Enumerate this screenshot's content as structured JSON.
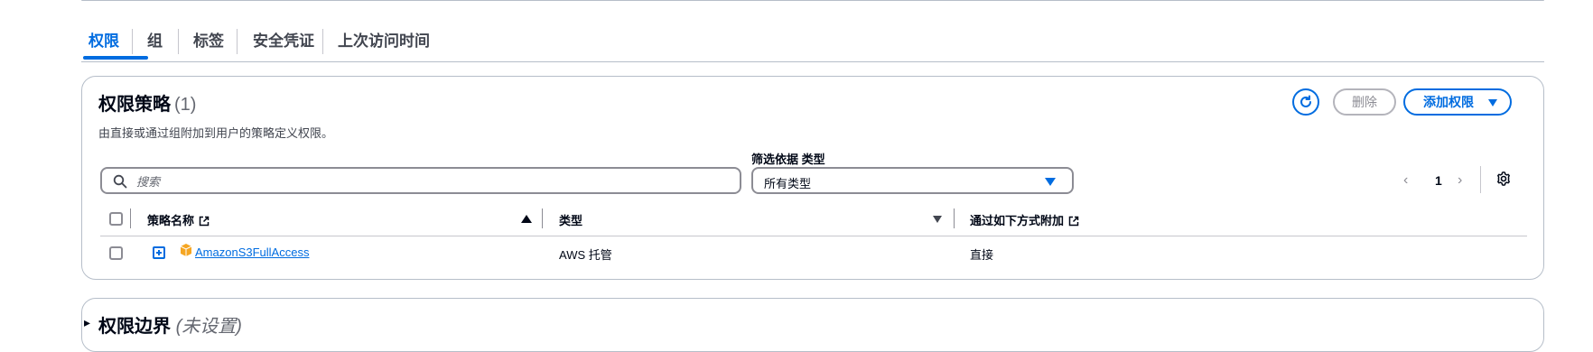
{
  "tabs": [
    {
      "label": "权限",
      "active": true
    },
    {
      "label": "组"
    },
    {
      "label": "标签"
    },
    {
      "label": "安全凭证"
    },
    {
      "label": "上次访问时间"
    }
  ],
  "policies": {
    "title": "权限策略",
    "count": "(1)",
    "description": "由直接或通过组附加到用户的策略定义权限。",
    "delete_label": "删除",
    "add_label": "添加权限",
    "filter_label": "筛选依据 类型",
    "search_placeholder": "搜索",
    "type_select_value": "所有类型",
    "page_number": "1",
    "columns": {
      "policy_name": "策略名称",
      "type": "类型",
      "attached_via": "通过如下方式附加"
    },
    "rows": [
      {
        "policy_name": "AmazonS3FullAccess",
        "type": "AWS 托管",
        "attached_via": "直接"
      }
    ]
  },
  "boundary": {
    "title": "权限边界",
    "subtitle": "(未设置)"
  },
  "colors": {
    "accent": "#006ce0",
    "border": "#b6bec9",
    "disabled": "#8c8c94",
    "aws_orange": "#f5a623"
  }
}
